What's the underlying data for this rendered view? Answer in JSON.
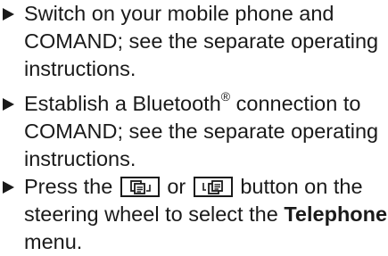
{
  "steps": [
    {
      "lines": [
        "Switch on your mobile phone and",
        "COMAND; see the separate operating",
        "instructions."
      ]
    },
    {
      "line1_pre": "Establish a Bluetooth",
      "line1_sup": "®",
      "line1_post": " connection to",
      "lines_rest": [
        "COMAND; see the separate operating",
        "instructions."
      ]
    },
    {
      "line1_pre": "Press the",
      "line1_mid": "or",
      "line1_post": "button on the",
      "line2_pre": "steering wheel to select the ",
      "line2_bold": "Telephone",
      "line3": "menu.",
      "icons": [
        "phone-book-back-button-icon",
        "phone-book-forward-button-icon"
      ]
    }
  ]
}
